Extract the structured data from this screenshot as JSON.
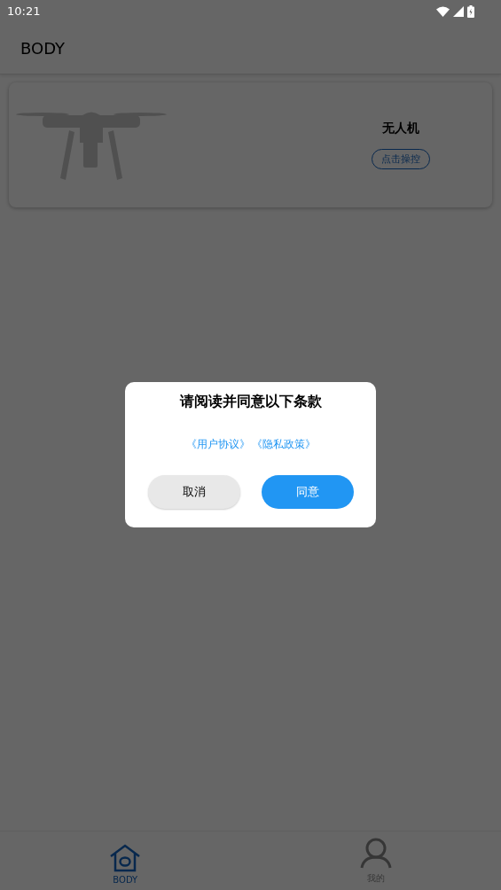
{
  "status_bar": {
    "time": "10:21"
  },
  "app_bar": {
    "title": "BODY"
  },
  "device_card": {
    "name": "无人机",
    "button": "点击操控"
  },
  "dialog": {
    "title": "请阅读并同意以下条款",
    "links": [
      "《用户协议》",
      "《隐私政策》"
    ],
    "buttons": [
      {
        "label": "取消",
        "kind": "secondary"
      },
      {
        "label": "同意",
        "kind": "primary"
      }
    ]
  },
  "bottom_nav": [
    {
      "label": "BODY",
      "kind": "home",
      "selected": true
    },
    {
      "label": "我的",
      "kind": "profile",
      "selected": false
    }
  ]
}
